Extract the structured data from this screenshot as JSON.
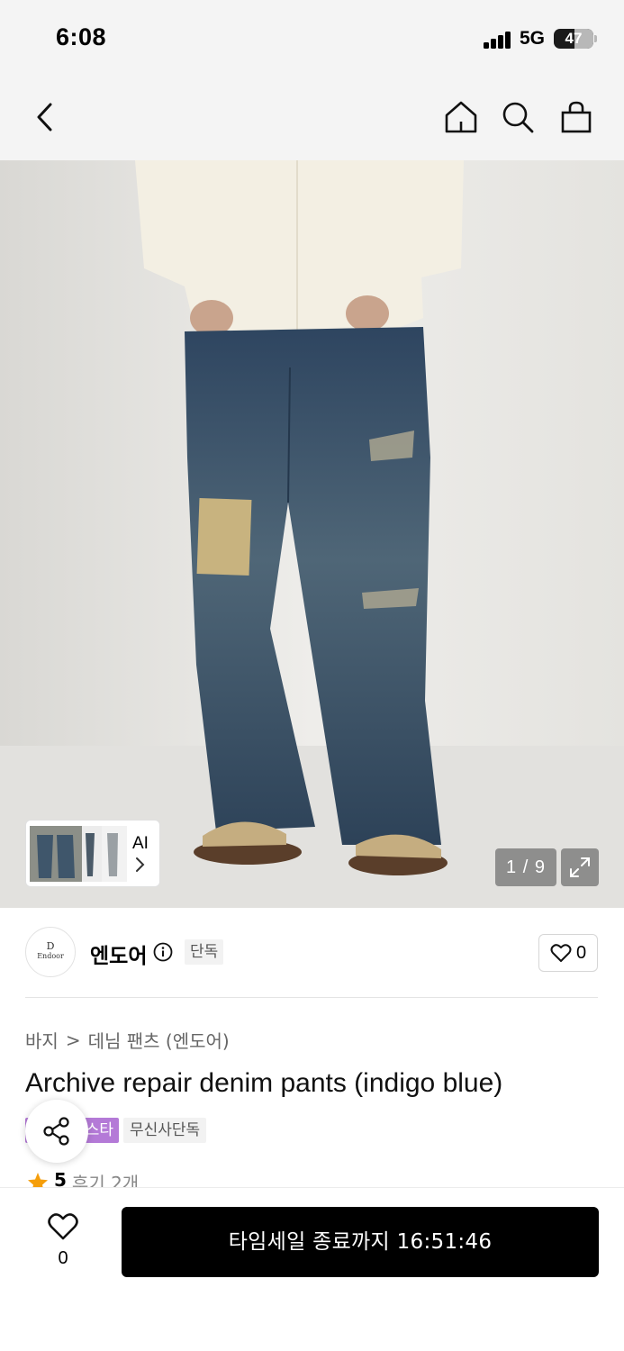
{
  "status_bar": {
    "time": "6:08",
    "network": "5G",
    "battery": "47",
    "battery_level": 0.47
  },
  "nav": {
    "back_icon": "chevron-left-icon",
    "home_icon": "home-icon",
    "search_icon": "search-icon",
    "cart_icon": "shopping-bag-icon"
  },
  "gallery": {
    "ai_label": "AI",
    "counter": "1 / 9"
  },
  "brand": {
    "logo_letter": "D",
    "logo_text": "Endoor",
    "name": "엔도어",
    "exclusive_tag": "단독",
    "like_count": "0"
  },
  "breadcrumb": {
    "category": "바지",
    "separator": ">",
    "subcategory": "데님 팬츠 (엔도어)"
  },
  "product": {
    "title": "Archive repair denim pants (indigo blue)",
    "badge_purple": "스타",
    "badge_gray": "무신사단독",
    "rating": "5",
    "review_text": "후기 2개"
  },
  "bottom": {
    "like_count": "0",
    "cta": "타임세일 종료까지 16:51:46"
  },
  "colors": {
    "accent_purple": "#b47ad7",
    "cta_bg": "#000000",
    "star": "#f59e0b"
  }
}
